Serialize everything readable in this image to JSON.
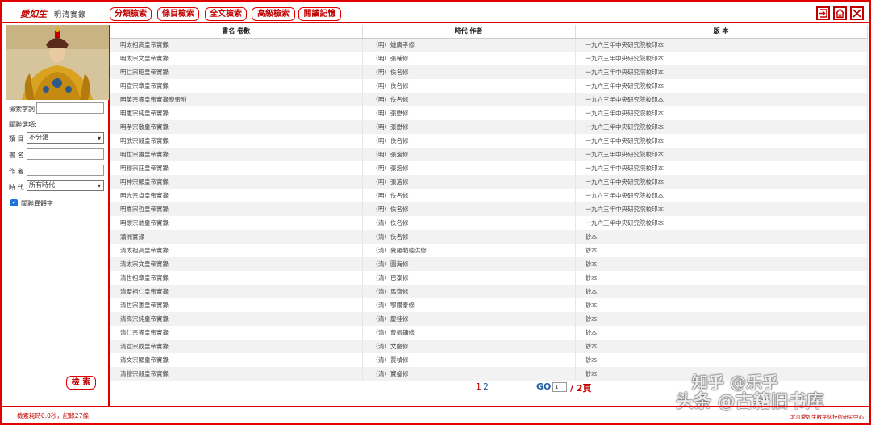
{
  "app": {
    "logo_text": "愛如生",
    "title": "明清實錄"
  },
  "nav": [
    {
      "label": "分類檢索"
    },
    {
      "label": "條目檢索"
    },
    {
      "label": "全文檢索"
    },
    {
      "label": "高級檢索"
    },
    {
      "label": "閱讀記憶"
    }
  ],
  "sidebar": {
    "search_term_label": "檢索字詞",
    "search_term_value": "",
    "related_options_label": "關聯選項:",
    "category_label": "類 目",
    "category_value": "不分類",
    "book_label": "書 名",
    "book_value": "",
    "author_label": "作 者",
    "author_value": "",
    "era_label": "時 代",
    "era_value": "所有時代",
    "variant_label": "關聯異體字",
    "search_button": "檢 索"
  },
  "table": {
    "headers": [
      "書名 卷數",
      "時代 作者",
      "版 本"
    ],
    "rows": [
      [
        "明太祖高皇帝實錄",
        "（明）姚廣孝修",
        "一九六三年中央研究院校印本"
      ],
      [
        "明太宗文皇帝實錄",
        "（明）張輔修",
        "一九六三年中央研究院校印本"
      ],
      [
        "明仁宗昭皇帝實錄",
        "（明）佚名修",
        "一九六三年中央研究院校印本"
      ],
      [
        "明宣宗章皇帝實錄",
        "（明）佚名修",
        "一九六三年中央研究院校印本"
      ],
      [
        "明英宗睿皇帝實錄廢帝附",
        "（明）佚名修",
        "一九六三年中央研究院校印本"
      ],
      [
        "明憲宗純皇帝實錄",
        "（明）張懋修",
        "一九六三年中央研究院校印本"
      ],
      [
        "明孝宗敬皇帝實錄",
        "（明）張懋修",
        "一九六三年中央研究院校印本"
      ],
      [
        "明武宗毅皇帝實錄",
        "（明）佚名修",
        "一九六三年中央研究院校印本"
      ],
      [
        "明世宗肅皇帝實錄",
        "（明）張溶修",
        "一九六三年中央研究院校印本"
      ],
      [
        "明穆宗莊皇帝實錄",
        "（明）張溶修",
        "一九六三年中央研究院校印本"
      ],
      [
        "明神宗顯皇帝實錄",
        "（明）張溶修",
        "一九六三年中央研究院校印本"
      ],
      [
        "明光宗貞皇帝實錄",
        "（明）佚名修",
        "一九六三年中央研究院校印本"
      ],
      [
        "明熹宗哲皇帝實錄",
        "（明）佚名修",
        "一九六三年中央研究院校印本"
      ],
      [
        "明懷宗端皇帝實錄",
        "（清）佚名修",
        "一九六三年中央研究院校印本"
      ],
      [
        "滿洲實錄",
        "（清）佚名修",
        "鈔本"
      ],
      [
        "清太祖高皇帝實錄",
        "（清）覺羅勒德洪修",
        "鈔本"
      ],
      [
        "清太宗文皇帝實錄",
        "（清）圖海修",
        "鈔本"
      ],
      [
        "清世祖章皇帝實錄",
        "（清）巴泰修",
        "鈔本"
      ],
      [
        "清聖祖仁皇帝實錄",
        "（清）馬齊修",
        "鈔本"
      ],
      [
        "清世宗憲皇帝實錄",
        "（清）鄂爾泰修",
        "鈔本"
      ],
      [
        "清高宗純皇帝實錄",
        "（清）慶桂修",
        "鈔本"
      ],
      [
        "清仁宗睿皇帝實錄",
        "（清）曹振鏞修",
        "鈔本"
      ],
      [
        "清宣宗成皇帝實錄",
        "（清）文慶修",
        "鈔本"
      ],
      [
        "清文宗顯皇帝實錄",
        "（清）賈楨修",
        "鈔本"
      ],
      [
        "清穆宗毅皇帝實錄",
        "（清）寶鋆修",
        "鈔本"
      ]
    ]
  },
  "pager": {
    "page1": "1",
    "page2": "2",
    "go_label": "GO",
    "go_value": "1",
    "total": "/ 2頁"
  },
  "status": {
    "text": "檢索耗時0.0秒，記錄27條",
    "org": "北京愛如生數字化技術研究中心"
  },
  "watermark": {
    "zhihu": "知乎 @乐乎",
    "toutiao": "头条 @古籍旧书库"
  },
  "colors": {
    "accent": "#e00000",
    "link": "#1e5fa8"
  }
}
